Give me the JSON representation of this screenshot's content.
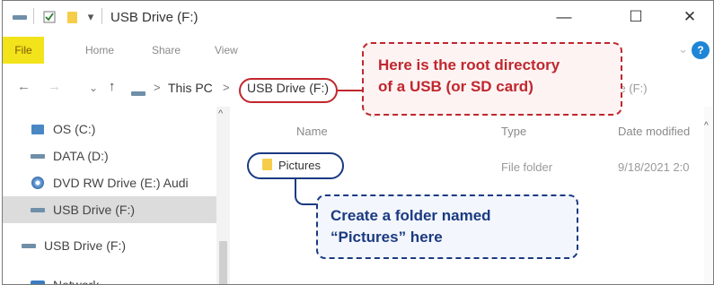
{
  "window": {
    "title": "USB Drive (F:)",
    "minimize_glyph": "—",
    "maximize_glyph": "☐",
    "close_glyph": "✕",
    "qat_dropdown_glyph": "▾"
  },
  "ribbon": {
    "tabs": [
      "File",
      "Home",
      "Share",
      "View"
    ],
    "expand_glyph": "⌄",
    "help_glyph": "?"
  },
  "address": {
    "back_glyph": "←",
    "forward_glyph": "→",
    "recent_glyph": "⌄",
    "up_glyph": "↑",
    "crumbs": [
      "This PC",
      "USB Drive (F:)"
    ],
    "crumb_separator": ">",
    "right_fragment": "ve (F:)"
  },
  "nav_pane": {
    "items": [
      {
        "label": "OS (C:)",
        "icon": "os-drive-icon"
      },
      {
        "label": "DATA (D:)",
        "icon": "drive-icon"
      },
      {
        "label": "DVD RW Drive (E:) Audi",
        "icon": "dvd-icon"
      },
      {
        "label": "USB Drive (F:)",
        "icon": "usb-drive-icon",
        "selected": true
      },
      {
        "label": "USB Drive (F:)",
        "icon": "usb-drive-icon"
      },
      {
        "label": "Network",
        "icon": "network-icon"
      }
    ],
    "scroll_up_glyph": "^"
  },
  "content": {
    "columns": [
      "Name",
      "Type",
      "Date modified"
    ],
    "rows": [
      {
        "name": "Pictures",
        "type": "File folder",
        "date": "9/18/2021 2:0"
      }
    ],
    "scroll_up_glyph": "^",
    "sort_glyph": "^"
  },
  "callouts": {
    "root": {
      "line1": "Here is the root directory",
      "line2": "of a USB (or SD card)"
    },
    "folder": {
      "line1": "Create a folder named",
      "line2": "“Pictures” here"
    }
  },
  "colors": {
    "file_tab": "#f2e31a",
    "callout_red": "#c0272d",
    "callout_blue": "#1b3a82",
    "selected_row": "#dcdcdc",
    "help_button": "#1f86d6"
  }
}
